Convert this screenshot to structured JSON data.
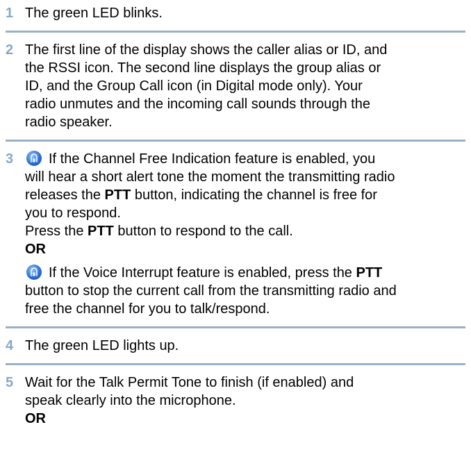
{
  "steps": [
    {
      "num": "1",
      "text": "The green LED blinks."
    },
    {
      "num": "2",
      "lines": [
        "The first line of the display shows the caller alias or ID, and",
        "the RSSI icon. The second line displays the group alias or",
        "ID, and the Group Call icon (in Digital mode only). Your",
        "radio unmutes and the incoming call sounds through the",
        "radio speaker."
      ]
    },
    {
      "num": "3",
      "p1_line1": "If the Channel Free Indication feature is enabled, you",
      "p1_line2": "will hear a short alert tone the moment the transmitting radio",
      "p1_line3_pre": "releases the ",
      "p1_line3_bold": "PTT",
      "p1_line3_post": " button, indicating the channel is free for",
      "p1_line4": "you to respond.",
      "p2_pre": "Press the ",
      "p2_bold": "PTT",
      "p2_post": " button to respond to the call.",
      "or": "OR",
      "p3_line1_pre": "If the Voice Interrupt feature is enabled, press the ",
      "p3_line1_bold": "PTT",
      "p3_line2": "button to stop the current call from the transmitting radio and",
      "p3_line3": "free the channel for you to talk/respond."
    },
    {
      "num": "4",
      "text": "The green LED lights up."
    },
    {
      "num": "5",
      "line1": "Wait for the Talk Permit Tone to finish (if enabled) and",
      "line2": "speak clearly into the microphone.",
      "or": "OR"
    }
  ],
  "icon": "option-feature-icon",
  "colors": {
    "number": "#86a8c6",
    "rule": "#9ab0c4",
    "icon": "#2b6fd6"
  }
}
